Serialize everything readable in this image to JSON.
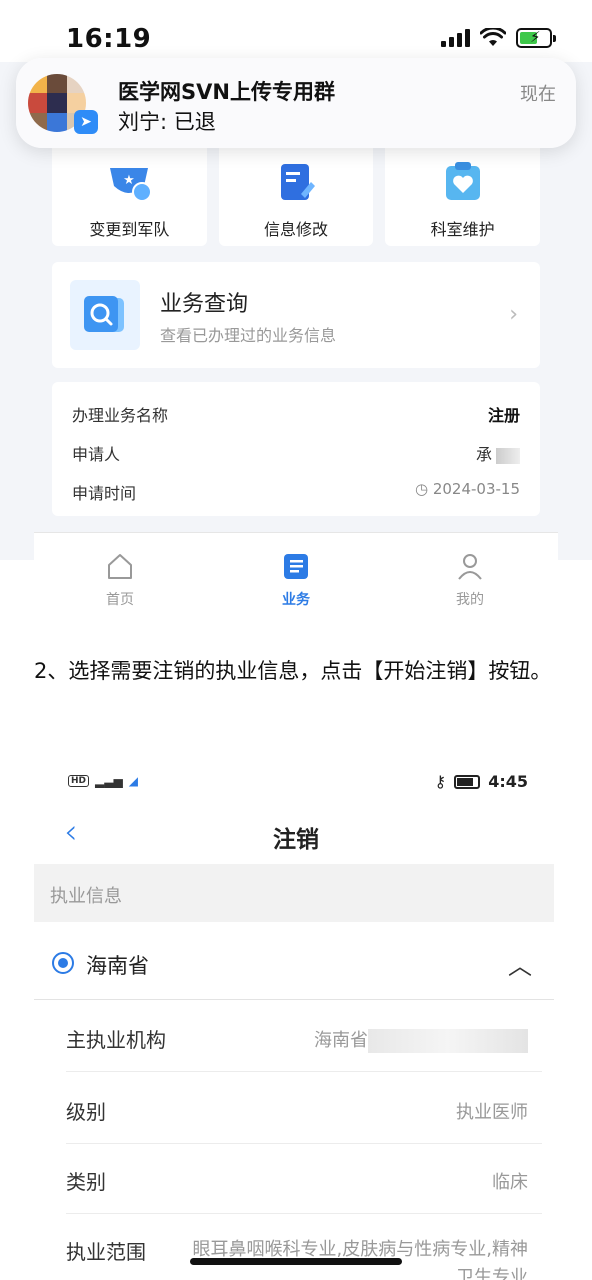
{
  "status_bar": {
    "time": "16:19"
  },
  "notification": {
    "group_name": "医学网SVN上传专用群",
    "message": "刘宁: 已退",
    "time": "现在"
  },
  "service_tiles": [
    {
      "label": "变更到军队",
      "icon": "military-badge-icon"
    },
    {
      "label": "信息修改",
      "icon": "edit-document-icon"
    },
    {
      "label": "科室维护",
      "icon": "heart-clipboard-icon"
    }
  ],
  "business_query": {
    "title": "业务查询",
    "subtitle": "查看已办理过的业务信息"
  },
  "record": {
    "name_label": "办理业务名称",
    "name_value": "注册",
    "applicant_label": "申请人",
    "applicant_value": "承",
    "time_label": "申请时间",
    "time_value": "2024-03-15"
  },
  "tabbar": {
    "home": "首页",
    "business": "业务",
    "mine": "我的"
  },
  "instruction": "2、选择需要注销的执业信息，点击【开始注销】按钮。",
  "screen2": {
    "status_time": "4:45",
    "title": "注销",
    "section_header": "执业信息",
    "province": "海南省",
    "rows": {
      "institution_label": "主执业机构",
      "institution_value": "海南省",
      "level_label": "级别",
      "level_value": "执业医师",
      "category_label": "类别",
      "category_value": "临床",
      "scope_label": "执业范围",
      "scope_value": "眼耳鼻咽喉科专业,皮肤病与性病专业,精神卫生专业"
    }
  },
  "colors": {
    "accent": "#2c7be5",
    "page_bg": "#f3f5f9"
  }
}
